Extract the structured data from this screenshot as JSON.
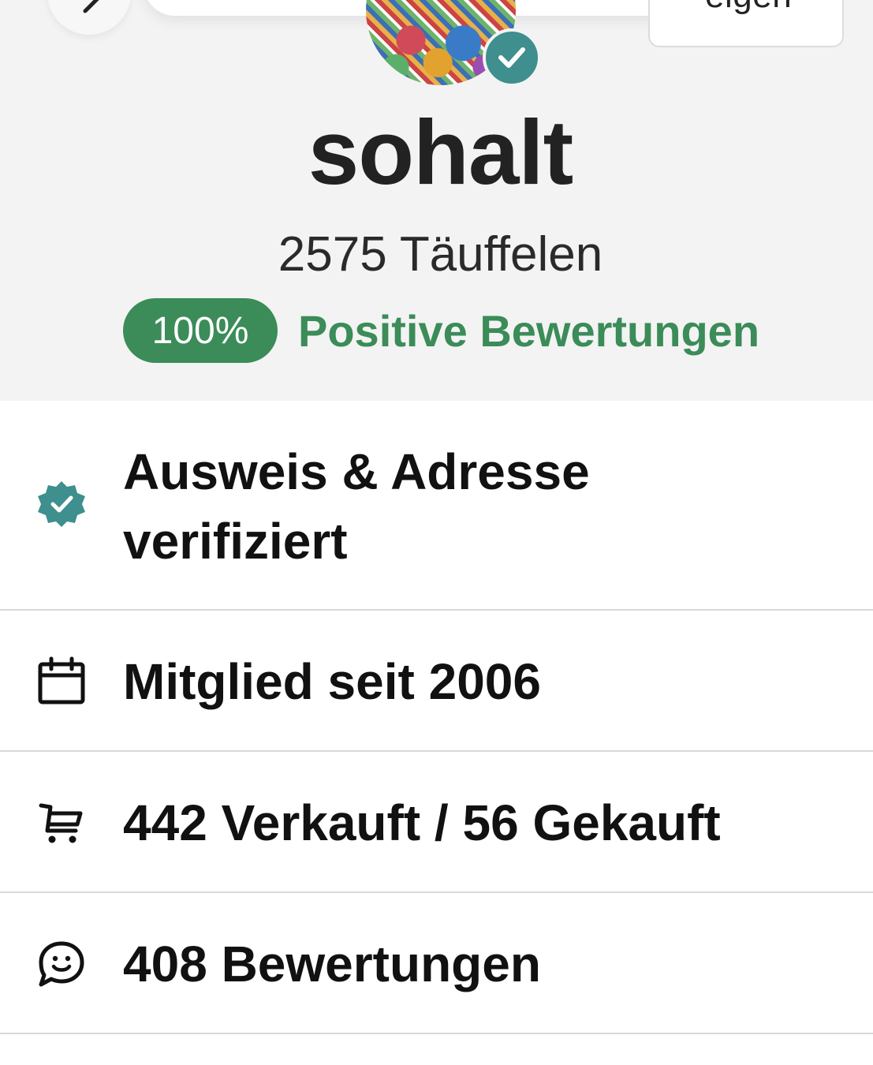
{
  "header": {
    "action_button_label": "eigen",
    "username": "sohalt",
    "location": "2575 Täuffelen",
    "rating_percent": "100%",
    "rating_label": "Positive Bewertungen"
  },
  "info": {
    "verified_line1": "Ausweis & Adresse",
    "verified_line2": "verifiziert",
    "member_since": "Mitglied seit 2006",
    "sold_bought": "442 Verkauft / 56 Gekauft",
    "reviews": "408 Bewertungen"
  },
  "colors": {
    "accent_green": "#3b8c58",
    "verified_teal": "#3e8f8d",
    "header_bg": "#f3f3f3",
    "divider": "#d9d9d9"
  },
  "icons": {
    "back": "chevron-left-icon",
    "verified": "verified-badge-icon",
    "calendar": "calendar-icon",
    "cart": "shopping-cart-icon",
    "reviews": "chat-smile-icon"
  }
}
